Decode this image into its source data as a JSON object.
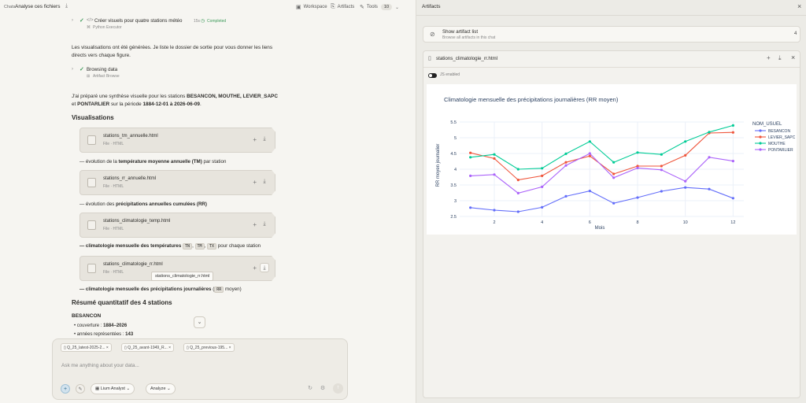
{
  "header": {
    "chats": "Chats",
    "title": "Analyse ces fichiers",
    "workspace": "Workspace",
    "artifacts": "Artifacts",
    "tools": "Tools",
    "tools_count": "10"
  },
  "conversation": {
    "step1": {
      "title": "Créer visuels pour quatre stations météo",
      "duration": "15s",
      "status": "Completed",
      "tool": "Python Executor"
    },
    "para1": "Les visualisations ont été générées. Je liste le dossier de sortie pour vous donner les liens directs vers chaque figure.",
    "step2": {
      "title": "Browsing data",
      "tool": "Artifact Browse"
    },
    "para2": {
      "t1": "J'ai préparé une synthèse visuelle pour les stations ",
      "s1": "BESANCON, MOUTHE,",
      "s2": "LEVIER_SAPC",
      "t2": " et ",
      "s3": "PONTARLIER",
      "t3": " sur la période ",
      "s4": "1884-12-01 à 2026-06-09",
      "t4": "."
    },
    "heading_visualisations": "Visualisations",
    "files": [
      {
        "name": "stations_tm_annuelle.html",
        "meta": "File · HTML"
      },
      {
        "name": "stations_rr_annuelle.html",
        "meta": "File · HTML"
      },
      {
        "name": "stations_climatologie_temp.html",
        "meta": "File · HTML"
      },
      {
        "name": "stations_climatologie_rr.html",
        "meta": "File · HTML"
      }
    ],
    "descs": {
      "d1a": "— évolution de la ",
      "d1b": "température moyenne annuelle (TM)",
      "d1c": " par station",
      "d2a": "— évolution des ",
      "d2b": "précipitations annuelles cumulées (RR)",
      "d3a": "— climatologie mensuelle des températures",
      "d3tn": "TN",
      "d3tm": "TM",
      "d3tx": "TX",
      "d3c": " pour chaque station",
      "d4a": "— climatologie mensuelle des précipitations journalières",
      "d4rr": "RR",
      "d4c": " moyen)"
    },
    "tooltip": "stations_climatologie_rr.html",
    "heading_resume": "Résumé quantitatif des 4 stations",
    "station": "BESANCON",
    "bullet1_label": "couverture : ",
    "bullet1_value": "1884–2026",
    "bullet2_label": "années représentées : ",
    "bullet2_value": "143"
  },
  "chat_input": {
    "attachments": [
      "Q_25_latest-2025-2...",
      "Q_25_avant-1949_R...",
      "Q_25_previous-195..."
    ],
    "placeholder": "Ask me anything about your data...",
    "agent": "Lium Analyst",
    "mode": "Analyze"
  },
  "artifacts_panel": {
    "title": "Artifacts",
    "show_list_title": "Show artifact list",
    "show_list_sub": "Browse all artifacts in this chat",
    "count": "4",
    "viewer_file": "stations_climatologie_rr.html",
    "js_enabled": "JS enabled"
  },
  "colors": {
    "BESANCON": "#636efa",
    "LEVIER_SAPC": "#ef553b",
    "MOUTHE": "#00cc96",
    "PONTARLIER": "#ab63fa"
  },
  "chart_data": {
    "type": "line",
    "title": "Climatologie mensuelle des précipitations journalières (RR moyen)",
    "xlabel": "Mois",
    "ylabel": "RR moyen journalier",
    "legend_title": "NOM_USUEL",
    "legend_position": "top-right",
    "xlim": [
      0.55,
      12.45
    ],
    "ylim": [
      2.5,
      5.5
    ],
    "x_ticks": [
      2,
      4,
      6,
      8,
      10,
      12
    ],
    "y_ticks": [
      2.5,
      3,
      3.5,
      4,
      4.5,
      5,
      5.5
    ],
    "x": [
      1,
      2,
      3,
      4,
      5,
      6,
      7,
      8,
      9,
      10,
      11,
      12
    ],
    "series": [
      {
        "name": "BESANCON",
        "values": [
          2.78,
          2.7,
          2.65,
          2.79,
          3.14,
          3.31,
          2.92,
          3.1,
          3.3,
          3.42,
          3.37,
          3.08
        ]
      },
      {
        "name": "LEVIER_SAPC",
        "values": [
          4.52,
          4.34,
          3.66,
          3.79,
          4.22,
          4.42,
          3.85,
          4.1,
          4.1,
          4.44,
          5.15,
          5.17
        ]
      },
      {
        "name": "MOUTHE",
        "values": [
          4.38,
          4.47,
          4.0,
          4.03,
          4.49,
          4.88,
          4.22,
          4.53,
          4.47,
          4.88,
          5.18,
          5.39
        ]
      },
      {
        "name": "PONTARLIER",
        "values": [
          3.79,
          3.83,
          3.24,
          3.44,
          4.12,
          4.5,
          3.73,
          4.04,
          3.98,
          3.62,
          4.38,
          4.26
        ]
      }
    ]
  }
}
